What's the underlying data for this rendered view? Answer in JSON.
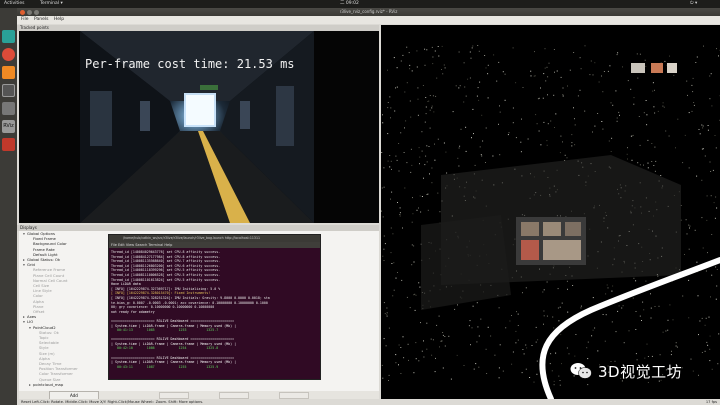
{
  "topbar": {
    "activities": "Activities",
    "app_menu": "Terminal ▾",
    "clock": "二 09:02"
  },
  "window": {
    "title": "r3live_rviz_config.rviz* - RViz"
  },
  "menu": [
    "File",
    "Panels",
    "Help"
  ],
  "tracked_points": {
    "title": "Tracked points",
    "overlay": "Per-frame cost time: 21.53 ms"
  },
  "displays": {
    "title": "Displays",
    "rows": [
      {
        "label": "Global Options",
        "caret": "▾",
        "dim": false
      },
      {
        "label": "Fixed Frame",
        "caret": "",
        "dim": false
      },
      {
        "label": "Background Color",
        "caret": "",
        "dim": false
      },
      {
        "label": "Frame Rate",
        "caret": "",
        "dim": false
      },
      {
        "label": "Default Light",
        "caret": "",
        "dim": false
      },
      {
        "label": "Global Status: Ok",
        "caret": "▸",
        "dim": false
      },
      {
        "label": "Grid",
        "caret": "▾",
        "dim": false
      },
      {
        "label": "Reference Frame",
        "caret": "",
        "dim": true
      },
      {
        "label": "Plane Cell Count",
        "caret": "",
        "dim": true
      },
      {
        "label": "Normal Cell Count",
        "caret": "",
        "dim": true
      },
      {
        "label": "Cell Size",
        "caret": "",
        "dim": true
      },
      {
        "label": "Line Style",
        "caret": "",
        "dim": true
      },
      {
        "label": "Color",
        "caret": "",
        "dim": true
      },
      {
        "label": "Alpha",
        "caret": "",
        "dim": true
      },
      {
        "label": "Plane",
        "caret": "",
        "dim": true
      },
      {
        "label": "Offset",
        "caret": "",
        "dim": true
      },
      {
        "label": "Axes",
        "caret": "▸",
        "dim": false
      },
      {
        "label": "LIO",
        "caret": "▾",
        "dim": false
      },
      {
        "label": "PointCloud2",
        "caret": "▾",
        "dim": false
      },
      {
        "label": "Status: Ok",
        "caret": "",
        "dim": true
      },
      {
        "label": "Topic",
        "caret": "",
        "dim": true
      },
      {
        "label": "Selectable",
        "caret": "",
        "dim": true
      },
      {
        "label": "Style",
        "caret": "",
        "dim": true
      },
      {
        "label": "Size (m)",
        "caret": "",
        "dim": true
      },
      {
        "label": "Alpha",
        "caret": "",
        "dim": true
      },
      {
        "label": "Decay Time",
        "caret": "",
        "dim": true
      },
      {
        "label": "Position Transformer",
        "caret": "",
        "dim": true
      },
      {
        "label": "Color Transformer",
        "caret": "",
        "dim": true
      },
      {
        "label": "Queue Size",
        "caret": "",
        "dim": true
      },
      {
        "label": "pointcloud_map",
        "caret": "▸",
        "dim": false
      }
    ],
    "add_button": "Add"
  },
  "terminal": {
    "title": "/home/hub/catkin_ws/src/r3live/r3live/launch/r3live_bag.launch http://localhost:11311",
    "menu": "File  Edit  View  Search  Terminal  Help",
    "lines": [
      {
        "t": "Thread_id [140084029643776] set CPU-8 affinity success.",
        "c": "b"
      },
      {
        "t": "Thread_id [140084127177984] set CPU-8 affinity success.",
        "c": "b"
      },
      {
        "t": "Thread_id [140081135568640] set CPU-7 affinity success.",
        "c": "b"
      },
      {
        "t": "Thread_id [140081126803200] set CPU-6 affinity success.",
        "c": "b"
      },
      {
        "t": "Thread_id [140081118399296] set CPU-5 affinity success.",
        "c": "b"
      },
      {
        "t": "Thread_id [140081110006528] set CPU-5 affinity success.",
        "c": "b"
      },
      {
        "t": "Thread_id [140081101613824] set CPU-5 affinity success.",
        "c": "b"
      },
      {
        "t": "Have LiDAR data",
        "c": "w"
      },
      {
        "t": "[ INFO] [1642229874.327369717]: IMU Initializing: 5.0 %",
        "c": "b"
      },
      {
        "t": "[ INFO] [1642229874.328015470]: Fixed Instruments!",
        "c": "y"
      },
      {
        "t": "[ INFO] [1642229874.328251324]: IMU Initials: Gravity: 9.8000 0.0000 0.0018; sta",
        "c": "b"
      },
      {
        "t": "te.bias_g: 0.0007 -0.0003 -0.0001; acc covarience: 0.10000000 0.10000000 0.1000",
        "c": "b"
      },
      {
        "t": "00; gry covarience: 0.10000000 0.10000000 0.10000000",
        "c": "b"
      },
      {
        "t": "not ready for odometry",
        "c": "w"
      },
      {
        "t": "",
        "c": "b"
      },
      {
        "t": "====================== R3LIVE Dashboard ======================",
        "c": "w"
      },
      {
        "t": "| System-time | LiDAR-frame | Camera-frame | Memory used (Mb) |",
        "c": "w"
      },
      {
        "t": "   00:41:13       1085            1253          1325.7",
        "c": "g"
      },
      {
        "t": "",
        "c": "b"
      },
      {
        "t": "====================== R3LIVE Dashboard ======================",
        "c": "w"
      },
      {
        "t": "| System-time | LiDAR-frame | Camera-frame | Memory used (Mb) |",
        "c": "w"
      },
      {
        "t": "   00:42:10       1086            1254          1325.8",
        "c": "g"
      },
      {
        "t": "",
        "c": "b"
      },
      {
        "t": "====================== R3LIVE Dashboard ======================",
        "c": "w"
      },
      {
        "t": "| System-time | LiDAR-frame | Camera-frame | Memory used (Mb) |",
        "c": "w"
      },
      {
        "t": "   00:43:11       1087            1255          1325.9",
        "c": "g"
      }
    ]
  },
  "status_bar": {
    "text": "Reset    Left-Click: Rotate.  Middle-Click: Move X/Y.  Right-Click/Mouse Wheel:: Zoom.  Shift: More options.",
    "fps": "17 fps"
  },
  "watermark": {
    "text": "3D视觉工坊"
  },
  "colors": {
    "terminal_bg": "#300a24",
    "launcher_bg": "#3c3b37",
    "panel_bg": "#dcdad5",
    "path_white": "#ffffff"
  }
}
